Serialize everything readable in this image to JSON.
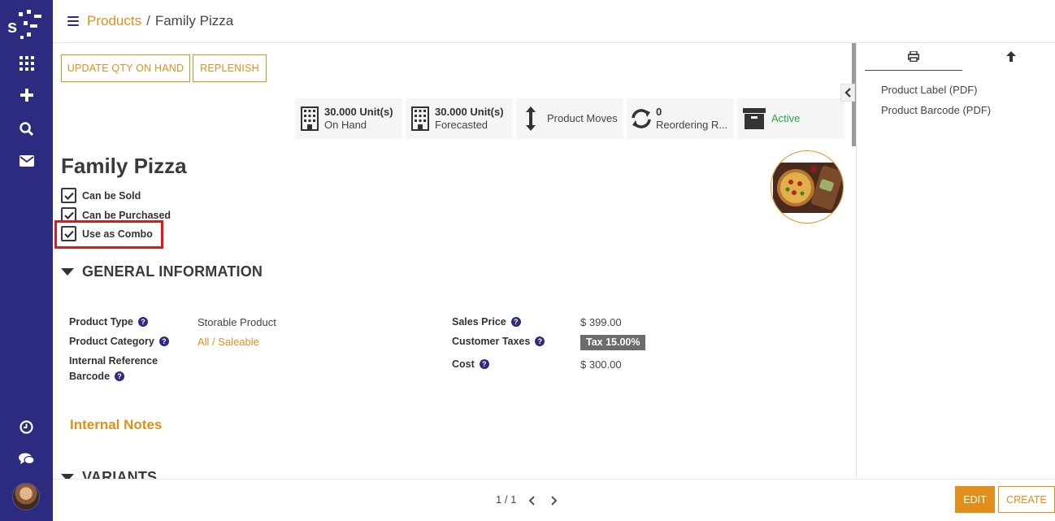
{
  "breadcrumb": {
    "parent": "Products",
    "separator": "/",
    "current": "Family Pizza"
  },
  "actions": {
    "update_qty": "UPDATE QTY ON HAND",
    "replenish": "REPLENISH"
  },
  "stats": {
    "on_hand": {
      "value": "30.000",
      "unit": "Unit(s)",
      "label": "On Hand"
    },
    "forecasted": {
      "value": "30.000",
      "unit": "Unit(s)",
      "label": "Forecasted"
    },
    "moves": {
      "label": "Product Moves"
    },
    "reordering": {
      "value": "0",
      "label": "Reordering R..."
    },
    "active": {
      "label": "Active"
    }
  },
  "product": {
    "name": "Family Pizza",
    "checkboxes": [
      {
        "label": "Can be Sold",
        "checked": true
      },
      {
        "label": "Can be Purchased",
        "checked": true
      },
      {
        "label": "Use as Combo",
        "checked": true
      }
    ]
  },
  "general": {
    "title": "GENERAL INFORMATION",
    "product_type_label": "Product Type",
    "product_type": "Storable Product",
    "category_label": "Product Category",
    "category": "All / Saleable",
    "internal_ref_label": "Internal Reference",
    "barcode_label": "Barcode",
    "sales_price_label": "Sales Price",
    "sales_price": "$ 399.00",
    "taxes_label": "Customer Taxes",
    "tax_tag": "Tax 15.00%",
    "cost_label": "Cost",
    "cost": "$ 300.00",
    "help_glyph": "?"
  },
  "notes": {
    "title": "Internal Notes"
  },
  "variants": {
    "title": "VARIANTS"
  },
  "side_panel": {
    "tabs": [
      "print-icon",
      "arrow-up-icon"
    ],
    "links": [
      "Product Label (PDF)",
      "Product Barcode (PDF)"
    ]
  },
  "footer": {
    "pager": "1 / 1",
    "edit": "EDIT",
    "create": "CREATE"
  },
  "colors": {
    "accent": "#e08f1c",
    "rail": "#2d2b80",
    "active": "#28a745",
    "highlight": "#e01919"
  }
}
